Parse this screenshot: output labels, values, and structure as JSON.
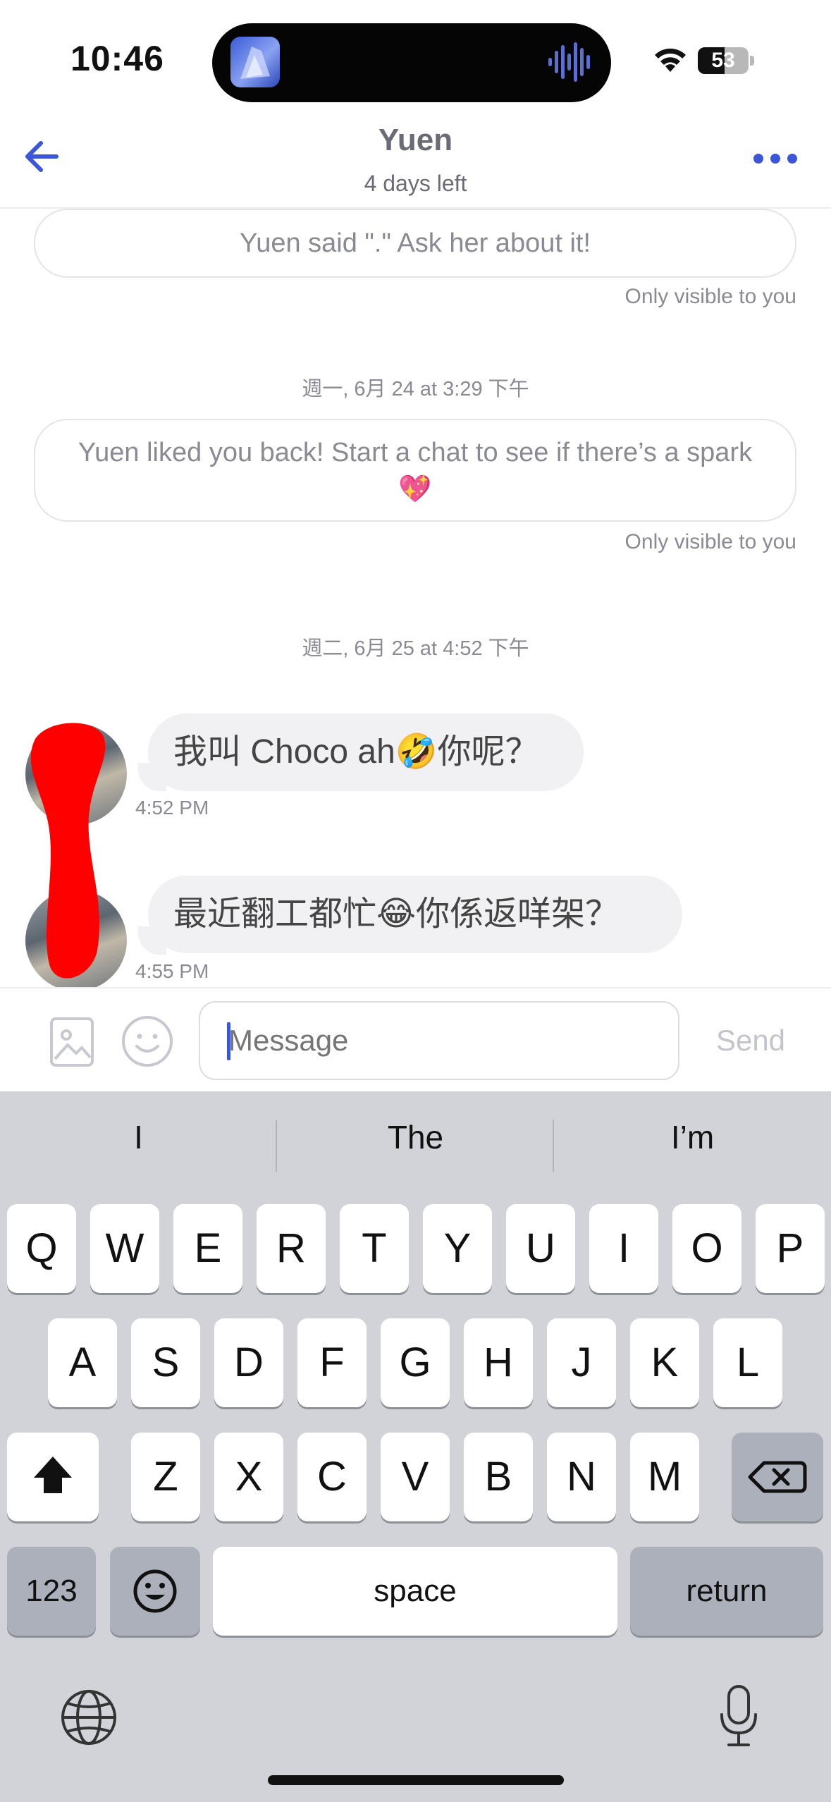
{
  "status_bar": {
    "time": "10:46",
    "battery_level": "53",
    "battery_fraction": 0.53,
    "icons": [
      "now-playing-artwork",
      "audio-waveform-icon",
      "wifi-icon",
      "battery-icon"
    ]
  },
  "header": {
    "name": "Yuen",
    "subtitle": "4 days left",
    "icons": [
      "back-arrow-icon",
      "more-dots-icon"
    ],
    "accent_color": "#3b56d9"
  },
  "chat": {
    "notices": [
      {
        "text": "Yuen said \".\" Ask her about it!",
        "note": "Only visible to you"
      },
      {
        "text": "Yuen liked you back! Start a chat to see if there’s a spark 💖",
        "note": "Only visible to you"
      }
    ],
    "date_separators": [
      "週一, 6月 24 at 3:29 下午",
      "週二, 6月 25 at 4:52 下午"
    ],
    "messages": [
      {
        "text": "我叫 Choco ah🤣你呢？",
        "time": "4:52 PM"
      },
      {
        "text": "最近翻工都忙😂你係返咩架？",
        "time": "4:55 PM"
      }
    ]
  },
  "composer": {
    "placeholder": "Message",
    "send_label": "Send",
    "icons": [
      "image-icon",
      "smiley-icon"
    ]
  },
  "keyboard": {
    "suggestions": [
      "I",
      "The",
      "I’m"
    ],
    "row1": [
      "Q",
      "W",
      "E",
      "R",
      "T",
      "Y",
      "U",
      "I",
      "O",
      "P"
    ],
    "row2": [
      "A",
      "S",
      "D",
      "F",
      "G",
      "H",
      "J",
      "K",
      "L"
    ],
    "row3": [
      "Z",
      "X",
      "C",
      "V",
      "B",
      "N",
      "M"
    ],
    "numbers_label": "123",
    "space_label": "space",
    "return_label": "return",
    "icons": [
      "shift-icon",
      "backspace-icon",
      "emoji-key-icon",
      "globe-icon",
      "microphone-icon"
    ]
  }
}
